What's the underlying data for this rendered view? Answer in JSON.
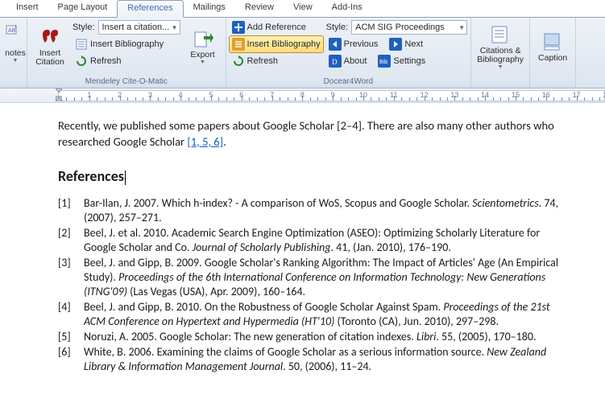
{
  "tabs": [
    "Insert",
    "Page Layout",
    "References",
    "Mailings",
    "Review",
    "View",
    "Add-Ins"
  ],
  "active_tab": "References",
  "ribbon": {
    "g1": {
      "notes_btn": "notes",
      "ab_btn": "AB"
    },
    "mendeley": {
      "label": "Mendeley Cite-O-Matic",
      "insert_citation": "Insert\nCitation",
      "style_label": "Style:",
      "style_value": "Insert a citation...",
      "insert_bib": "Insert Bibliography",
      "refresh": "Refresh",
      "export": "Export"
    },
    "docear": {
      "label": "Docear4Word",
      "add_ref": "Add Reference",
      "insert_bib": "Insert Bibliography",
      "refresh": "Refresh",
      "style_label": "Style:",
      "style_value": "ACM SIG Proceedings",
      "previous": "Previous",
      "next": "Next",
      "about": "About",
      "settings": "Settings"
    },
    "citations_bib": "Citations &\nBibliography",
    "caption": "Caption"
  },
  "doc": {
    "p1a": "Recently, we published some papers about Google Scholar [2–4]. There are also many other authors who researched Google Scholar ",
    "p1link": "[1, 5, 6]",
    "p1b": ".",
    "heading": "References",
    "refs": [
      {
        "n": "[1]",
        "a": "Bar-Ilan, J. 2007.  Which h-index? - A comparison of WoS, Scopus and Google Scholar. ",
        "i": "Scientometrics",
        "b": ". 74, (2007), 257–271."
      },
      {
        "n": "[2]",
        "a": "Beel, J. et al. 2010.  Academic Search Engine Optimization (ASEO): Optimizing Scholarly Literature for Google Scholar and Co. ",
        "i": "Journal of Scholarly Publishing",
        "b": ". 41, (Jan. 2010), 176–190."
      },
      {
        "n": "[3]",
        "a": "Beel, J. and Gipp, B. 2009.  Google Scholar's Ranking Algorithm: The Impact of Articles' Age (An Empirical Study). ",
        "i": "Proceedings of the 6th International Conference on Information Technology: New Generations (ITNG'09)",
        "b": " (Las Vegas (USA), Apr. 2009), 160–164."
      },
      {
        "n": "[4]",
        "a": "Beel, J. and Gipp, B. 2010.  On the Robustness of Google Scholar Against Spam. ",
        "i": "Proceedings of the 21st ACM Conference on Hypertext and Hypermedia (HT'10)",
        "b": " (Toronto (CA), Jun. 2010), 297–298."
      },
      {
        "n": "[5]",
        "a": "Noruzi, A. 2005.  Google Scholar: The new generation of citation indexes. ",
        "i": "Libri",
        "b": ". 55, (2005), 170–180."
      },
      {
        "n": "[6]",
        "a": "White, B. 2006.  Examining the claims of Google Scholar as a serious information source. ",
        "i": "New Zealand Library & Information Management Journal",
        "b": ". 50, (2006), 11–24."
      }
    ]
  }
}
